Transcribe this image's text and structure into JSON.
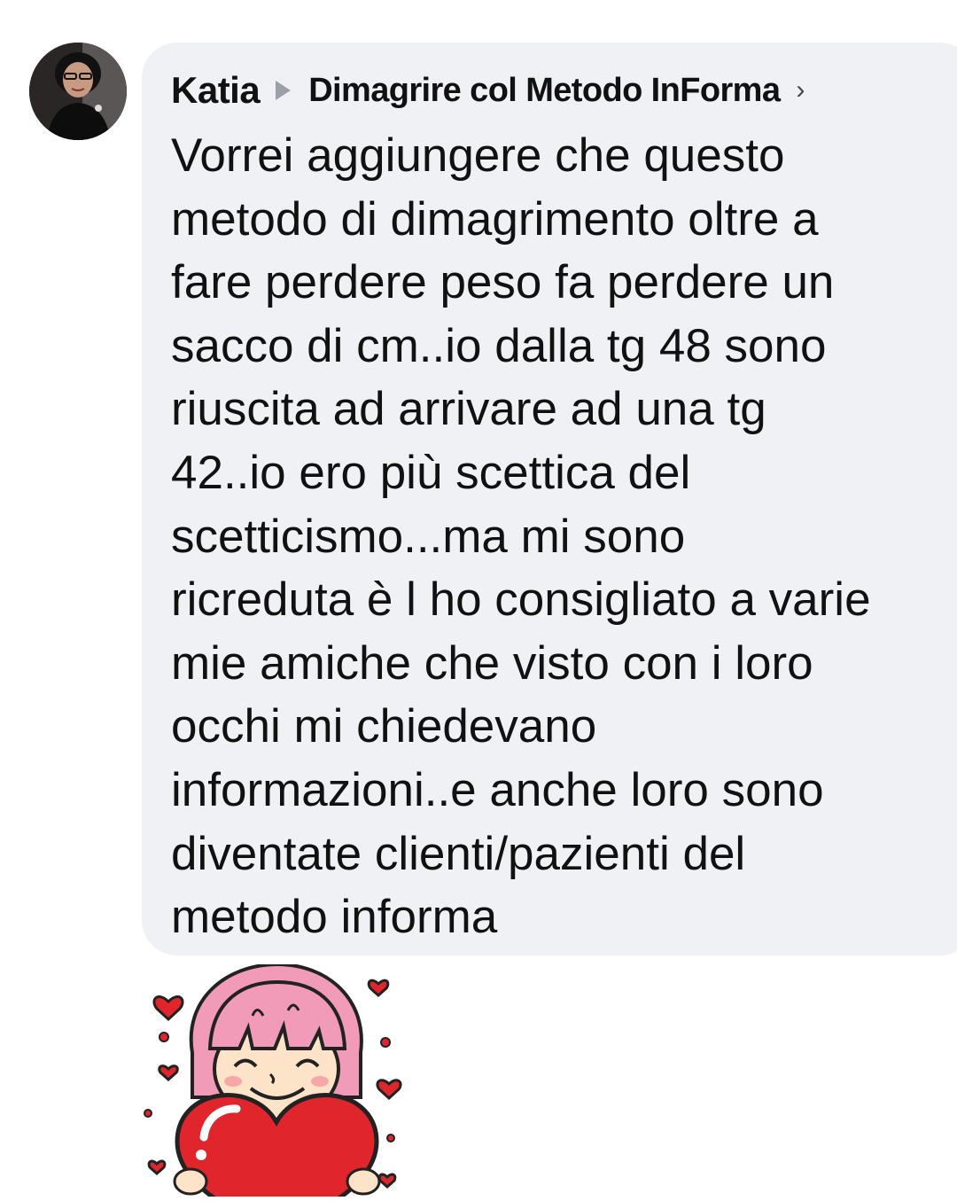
{
  "post": {
    "author": "Katia",
    "group": "Dimagrire col Metodo InForma",
    "chevron": "›",
    "comment": "Vorrei aggiungere che questo\nmetodo di dimagrimento oltre a\nfare perdere peso fa perdere un\nsacco di cm..io dalla tg 48 sono\nriuscita ad arrivare ad una tg\n42..io ero più scettica del\nscetticismo...ma mi sono\nricreduta è l ho consigliato a varie\nmie amiche che visto con i loro\nocchi mi chiedevano\ninformazioni..e anche loro sono\ndiventate clienti/pazienti del\nmetodo informa"
  },
  "icons": {
    "arrow": "triangle-right-icon",
    "chevron": "chevron-right-icon",
    "sticker": "girl-holding-heart-sticker"
  },
  "colors": {
    "bubble": "#f0f1f4",
    "text": "#111111",
    "arrow": "#9aa0a8",
    "heart": "#e0262c",
    "hair": "#f29bb8"
  }
}
